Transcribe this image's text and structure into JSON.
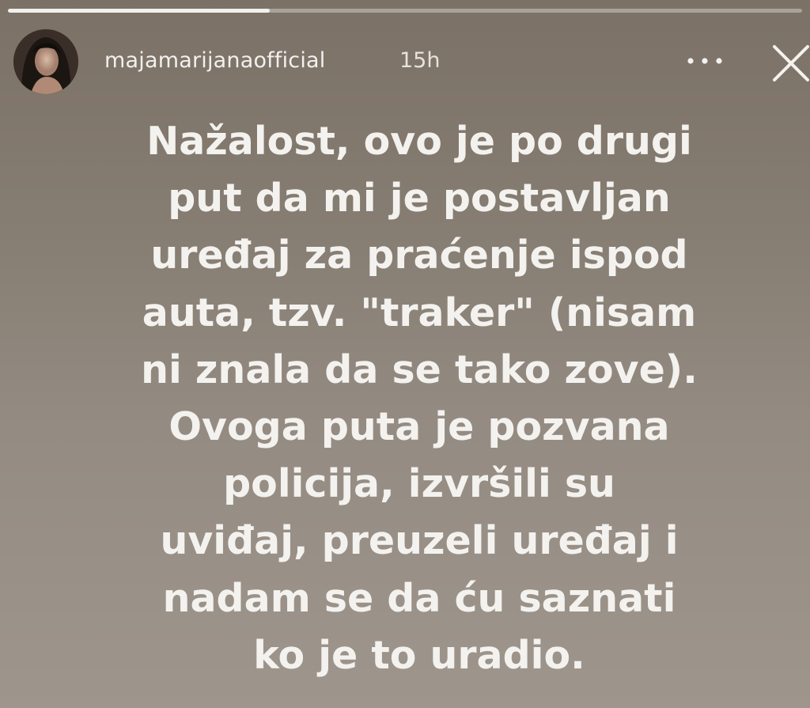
{
  "story": {
    "progress": 0.33,
    "username": "majamarijanaofficial",
    "time": "15h",
    "lines": [
      "Nažalost, ovo je po drugi",
      "put da mi je postavljan",
      "uređaj za praćenje ispod",
      "auta, tzv. \"traker\" (nisam",
      "ni znala da se tako zove).",
      "Ovoga puta je pozvana",
      "policija, izvršili su",
      "uviđaj, preuzeli uređaj i",
      "nadam se da ću saznati",
      "ko je to uradio."
    ]
  },
  "icons": {
    "more": "more-horizontal-icon",
    "close": "close-icon"
  },
  "colors": {
    "text": "#f4f2ef",
    "background_top": "#7b7166",
    "background_bottom": "#9e958c"
  }
}
